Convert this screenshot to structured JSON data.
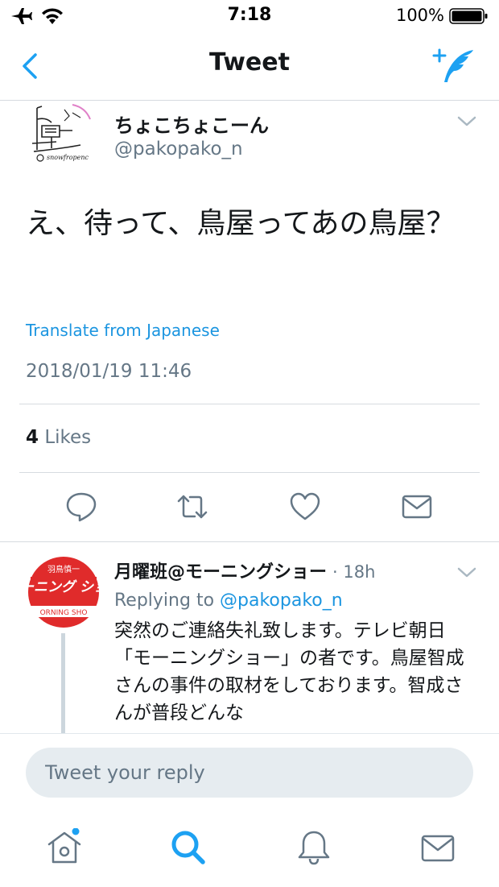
{
  "status_bar": {
    "time": "7:18",
    "battery": "100%",
    "icons": [
      "airplane-icon",
      "wifi-icon",
      "battery-icon"
    ]
  },
  "nav": {
    "title": "Tweet",
    "back_icon": "chevron-left-icon",
    "compose_icon": "compose-tweet-icon"
  },
  "tweet": {
    "display_name": "ちょこちょこーん",
    "handle": "@pakopako_n",
    "text": "え、待って、鳥屋ってあの鳥屋？",
    "translate_label": "Translate from Japanese",
    "timestamp": "2018/01/19 11:46",
    "likes_count": "4",
    "likes_label": "Likes",
    "avatar_caption": "snowfropenc"
  },
  "actions": [
    "reply-icon",
    "retweet-icon",
    "like-icon",
    "direct-message-icon"
  ],
  "reply": {
    "display_name": "月曜班@モーニングショー",
    "time": "· 18h",
    "replying_prefix": "Replying to",
    "replying_handle": "@pakopako_n",
    "text": "突然のご連絡失礼致します。テレビ朝日「モーニングショー」の者です。鳥屋智成さんの事件の取材をしております。智成さんが普段どんな",
    "avatar_text_top": "羽鳥慎一",
    "avatar_text_main": "モーニング ショー",
    "avatar_text_bottom": "ORNING SHO"
  },
  "reply_bar": {
    "placeholder": "Tweet your reply"
  },
  "tab_bar": {
    "items": [
      "home-icon",
      "search-icon",
      "notifications-icon",
      "messages-icon"
    ],
    "accent": "#1da1f2"
  },
  "colors": {
    "accent": "#1da1f2",
    "link": "#1b95e0",
    "secondary_text": "#657786",
    "primary_text": "#14171a"
  }
}
